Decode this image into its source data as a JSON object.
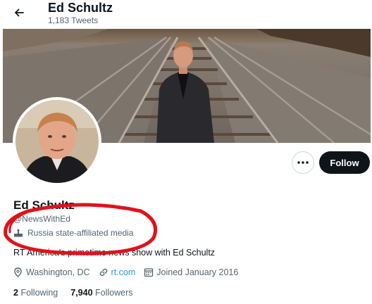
{
  "header": {
    "name": "Ed Schultz",
    "tweet_count": "1,183 Tweets"
  },
  "profile": {
    "name": "Ed Schultz",
    "handle": "@NewsWithEd",
    "label": "Russia state-affiliated media",
    "bio": "RT America's primetime news show with Ed Schultz",
    "location": "Washington, DC",
    "website": "rt.com",
    "joined": "Joined January 2016",
    "following_count": "2",
    "following_label": "Following",
    "followers_count": "7,940",
    "followers_label": "Followers"
  },
  "actions": {
    "follow_label": "Follow"
  },
  "colors": {
    "accent": "#1d9bf0",
    "annotation": "#e0121a",
    "follow_bg": "#0f1419"
  },
  "icons": [
    "back-arrow-icon",
    "more-icon",
    "state-media-icon",
    "location-icon",
    "link-icon",
    "calendar-icon"
  ]
}
